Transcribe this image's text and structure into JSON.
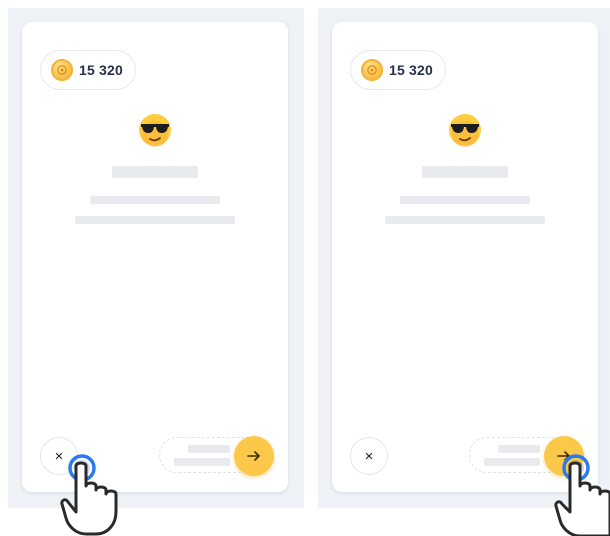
{
  "left_panel": {
    "coins": {
      "count": "15 320",
      "icon": "coin-icon"
    },
    "emoji": "sunglasses-face-emoji",
    "close_icon": "close-icon",
    "close_label": "×",
    "next_icon": "arrow-right-icon",
    "highlighted_action": "close",
    "pointer_icon": "hand-pointer-icon"
  },
  "right_panel": {
    "coins": {
      "count": "15 320",
      "icon": "coin-icon"
    },
    "emoji": "sunglasses-face-emoji",
    "close_icon": "close-icon",
    "close_label": "×",
    "next_icon": "arrow-right-icon",
    "highlighted_action": "next",
    "pointer_icon": "hand-pointer-icon"
  },
  "colors": {
    "background_panel": "#eef1f6",
    "card": "#ffffff",
    "placeholder": "#e9eaee",
    "accent": "#fbc84a",
    "tap_ring": "#2b7bf0",
    "coin": "#f6b93b"
  }
}
